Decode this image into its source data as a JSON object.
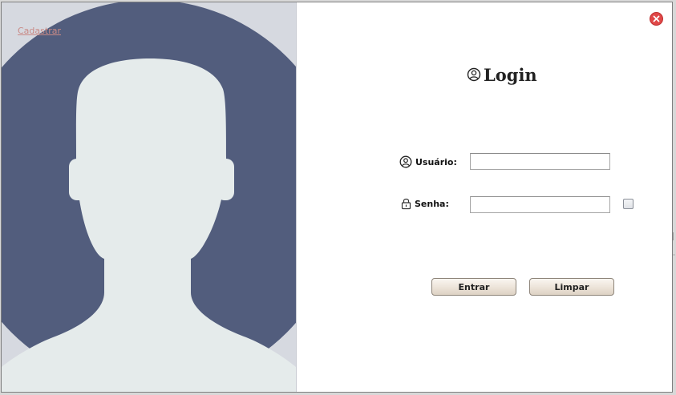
{
  "window": {
    "cadastrar_link": "Cadastrar",
    "close_icon": "close-circle-icon"
  },
  "login": {
    "title": "Login",
    "title_icon": "user-circle-icon",
    "username_label": "Usuário:",
    "username_icon": "user-circle-icon",
    "username_value": "",
    "password_label": "Senha:",
    "password_icon": "padlock-icon",
    "password_value": "",
    "show_password_checked": false
  },
  "buttons": {
    "enter_label": "Entrar",
    "clear_label": "Limpar"
  },
  "colors": {
    "avatar_background": "#525d7d",
    "avatar_silhouette": "#e5ebeb",
    "panel_background": "#d6d9e0",
    "close_button": "#e04848",
    "link": "#c98a86"
  }
}
